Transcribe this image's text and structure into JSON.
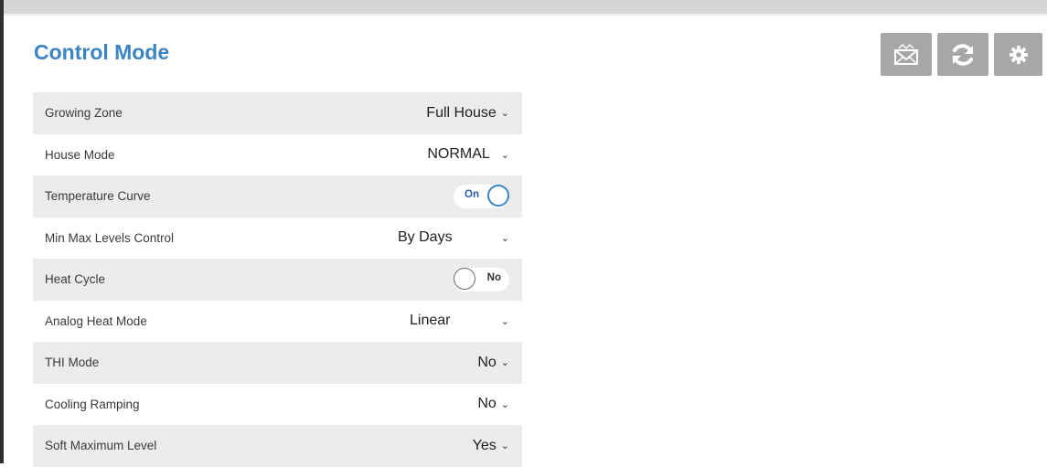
{
  "page": {
    "title": "Control Mode"
  },
  "toolbar": {
    "buttons": [
      {
        "name": "message-button",
        "icon": "envelope-icon"
      },
      {
        "name": "refresh-button",
        "icon": "refresh-icon"
      },
      {
        "name": "settings-button",
        "icon": "gear-icon"
      }
    ]
  },
  "settings": {
    "growing_zone": {
      "label": "Growing Zone",
      "value": "Full House"
    },
    "house_mode": {
      "label": "House Mode",
      "value": "NORMAL"
    },
    "temperature_curve": {
      "label": "Temperature Curve",
      "state": "On"
    },
    "min_max_levels_control": {
      "label": "Min Max Levels Control",
      "value": "By Days"
    },
    "heat_cycle": {
      "label": "Heat Cycle",
      "state": "No"
    },
    "analog_heat_mode": {
      "label": "Analog Heat Mode",
      "value": "Linear"
    },
    "thi_mode": {
      "label": "THI Mode",
      "value": "No"
    },
    "cooling_ramping": {
      "label": "Cooling Ramping",
      "value": "No"
    },
    "soft_maximum_level": {
      "label": "Soft Maximum Level",
      "value": "Yes"
    }
  },
  "colors": {
    "title": "#3c84c4",
    "toolbar_button": "#a7a7a7",
    "row_shaded": "#ececec",
    "toggle_on": "#3c84c4"
  }
}
